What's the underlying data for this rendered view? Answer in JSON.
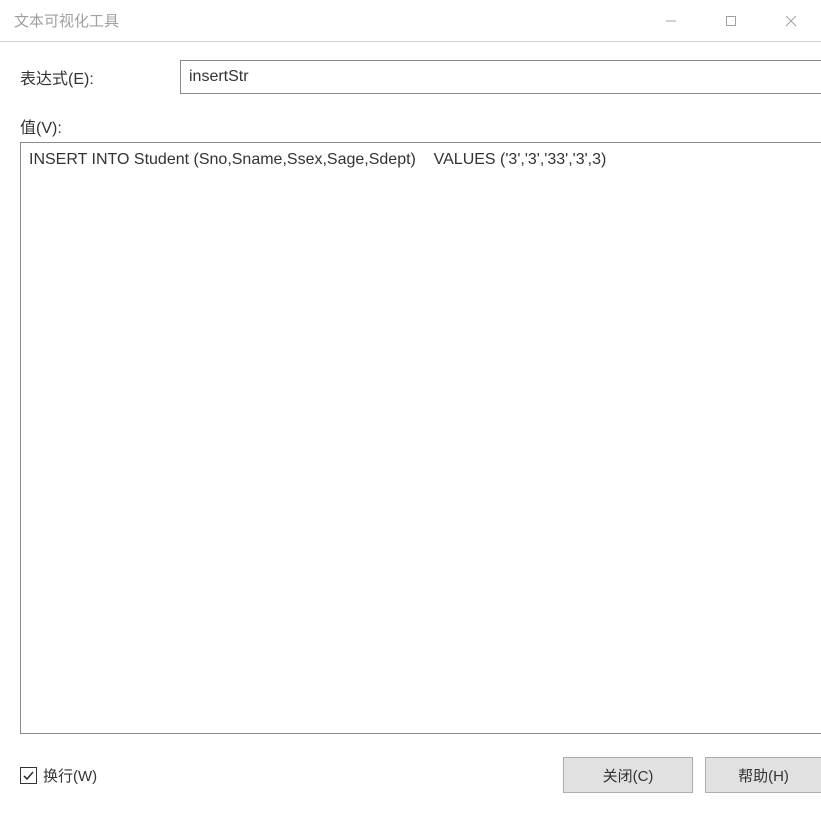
{
  "titlebar": {
    "title": "文本可视化工具"
  },
  "form": {
    "expression_label": "表达式(E):",
    "expression_value": "insertStr",
    "value_label": "值(V):",
    "value_text": "INSERT INTO Student (Sno,Sname,Ssex,Sage,Sdept)    VALUES ('3','3','33','3',3)"
  },
  "bottom": {
    "wrap_label": "换行(W)",
    "wrap_checked": true,
    "close_label": "关闭(C)",
    "help_label": "帮助(H)"
  }
}
